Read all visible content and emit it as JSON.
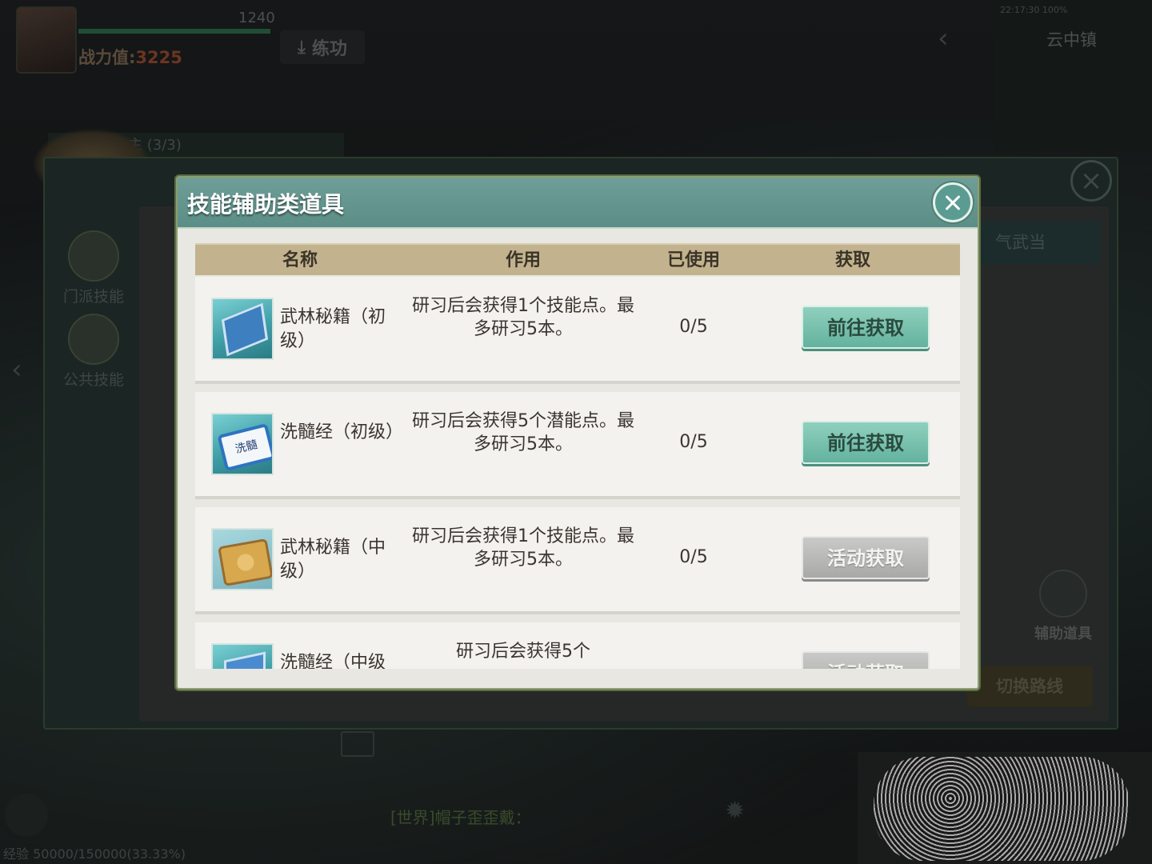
{
  "background": {
    "level": "1240",
    "power_label": "战力值:",
    "power_value": "3225",
    "train_label": "练功",
    "status_text": "22:17:30 100%",
    "location": "云中镇",
    "quest_text": "主 (3/3)",
    "tab_sect_skill": "门派技能",
    "tab_public_skill": "公共技能",
    "right_tab": "气武当",
    "aux_items": "辅助道具",
    "switch_route": "切换路线",
    "chat_text": "[世界]帽子歪歪戴：",
    "exp_text": "经验 50000/150000(33.33%)"
  },
  "dialog": {
    "title": "技能辅助类道具",
    "columns": {
      "name": "名称",
      "effect": "作用",
      "used": "已使用",
      "get": "获取"
    },
    "items": [
      {
        "icon": "martial-manual-book-icon",
        "name": "武林秘籍（初级）",
        "effect": "研习后会获得1个技能点。最多研习5本。",
        "used": "0/5",
        "button": "前往获取",
        "button_style": "teal"
      },
      {
        "icon": "marrow-scroll-icon",
        "name": "洗髓经（初级）",
        "effect": "研习后会获得5个潜能点。最多研习5本。",
        "used": "0/5",
        "button": "前往获取",
        "button_style": "teal"
      },
      {
        "icon": "gold-scroll-icon",
        "name": "武林秘籍（中级）",
        "effect": "研习后会获得1个技能点。最多研习5本。",
        "used": "0/5",
        "button": "活动获取",
        "button_style": "gray"
      },
      {
        "icon": "marrow-book-icon",
        "name": "洗髓经（中级",
        "effect": "研习后会获得5个",
        "used": "",
        "button": "活动获取",
        "button_style": "gray"
      }
    ]
  },
  "colors": {
    "header_teal": "#5b8e86",
    "table_head": "#c2b38e",
    "button_teal": "#63b29f",
    "button_gray": "#a9a9a7"
  }
}
